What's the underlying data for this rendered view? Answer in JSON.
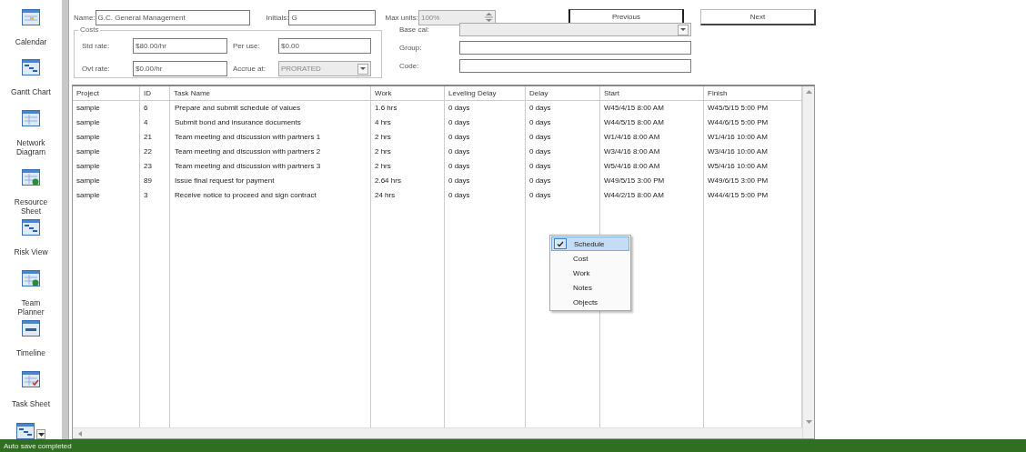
{
  "sidebar": {
    "items": [
      {
        "label": "Calendar"
      },
      {
        "label": "Gantt Chart"
      },
      {
        "label": "Network Diagram"
      },
      {
        "label": "Resource Sheet"
      },
      {
        "label": "Risk View"
      },
      {
        "label": "Team Planner"
      },
      {
        "label": "Timeline"
      },
      {
        "label": "Task Sheet"
      }
    ]
  },
  "form": {
    "name": {
      "label": "Name:",
      "value": "G.C. General Management"
    },
    "initials": {
      "label": "Initials:",
      "value": "G"
    },
    "max_units": {
      "label": "Max units:",
      "value": "100%",
      "disabled": true
    },
    "buttons": [
      {
        "label": "Previous",
        "focused": true
      },
      {
        "label": "Next",
        "focused": false
      }
    ],
    "costs": {
      "title": "Costs",
      "fields": [
        {
          "label": "Std rate:",
          "value": "$80.00/hr",
          "kind": "text",
          "disabled": false
        },
        {
          "label": "Per use:",
          "value": "$0.00",
          "kind": "text",
          "disabled": false
        },
        {
          "label": "Ovt rate:",
          "value": "$0.00/hr",
          "kind": "text",
          "disabled": false
        },
        {
          "label": "Accrue at:",
          "value": "PRORATED",
          "kind": "select",
          "disabled": true
        }
      ]
    },
    "details": [
      {
        "label": "Base cal:",
        "kind": "select",
        "disabled": true
      },
      {
        "label": "Group:",
        "kind": "text",
        "disabled": false
      },
      {
        "label": "Code:",
        "kind": "text",
        "disabled": false
      }
    ]
  },
  "table": {
    "columns": [
      "Project",
      "ID",
      "Task Name",
      "Work",
      "Leveling Delay",
      "Delay",
      "Start",
      "Finish"
    ],
    "rows": [
      [
        "sample",
        "6",
        "Prepare and submit schedule of values",
        "1.6 hrs",
        "0 days",
        "0 days",
        "W45/4/15 8:00 AM",
        "W45/5/15 5:00 PM"
      ],
      [
        "sample",
        "4",
        "Submit bond and insurance documents",
        "4 hrs",
        "0 days",
        "0 days",
        "W44/5/15 8:00 AM",
        "W44/6/15 5:00 PM"
      ],
      [
        "sample",
        "21",
        "Team meeting and discussion with partners 1",
        "2 hrs",
        "0 days",
        "0 days",
        "W1/4/16 8:00 AM",
        "W1/4/16 10:00 AM"
      ],
      [
        "sample",
        "22",
        "Team meeting and discussion with partners 2",
        "2 hrs",
        "0 days",
        "0 days",
        "W3/4/16 8:00 AM",
        "W3/4/16 10:00 AM"
      ],
      [
        "sample",
        "23",
        "Team meeting and discussion with partners 3",
        "2 hrs",
        "0 days",
        "0 days",
        "W5/4/16 8:00 AM",
        "W5/4/16 10:00 AM"
      ],
      [
        "sample",
        "89",
        "Issue final request for payment",
        "2.64 hrs",
        "0 days",
        "0 days",
        "W49/5/15 3:00 PM",
        "W49/6/15 3:00 PM"
      ],
      [
        "sample",
        "3",
        "Receive notice to proceed and sign contract",
        "24 hrs",
        "0 days",
        "0 days",
        "W44/2/15 8:00 AM",
        "W44/4/15 5:00 PM"
      ]
    ]
  },
  "context_menu": {
    "items": [
      {
        "label": "Schedule",
        "checked": true,
        "selected": true
      },
      {
        "label": "Cost",
        "checked": false,
        "selected": false
      },
      {
        "label": "Work",
        "checked": false,
        "selected": false
      },
      {
        "label": "Notes",
        "checked": false,
        "selected": false
      },
      {
        "label": "Objects",
        "checked": false,
        "selected": false
      }
    ]
  },
  "status_bar": {
    "text": "Auto save completed"
  }
}
